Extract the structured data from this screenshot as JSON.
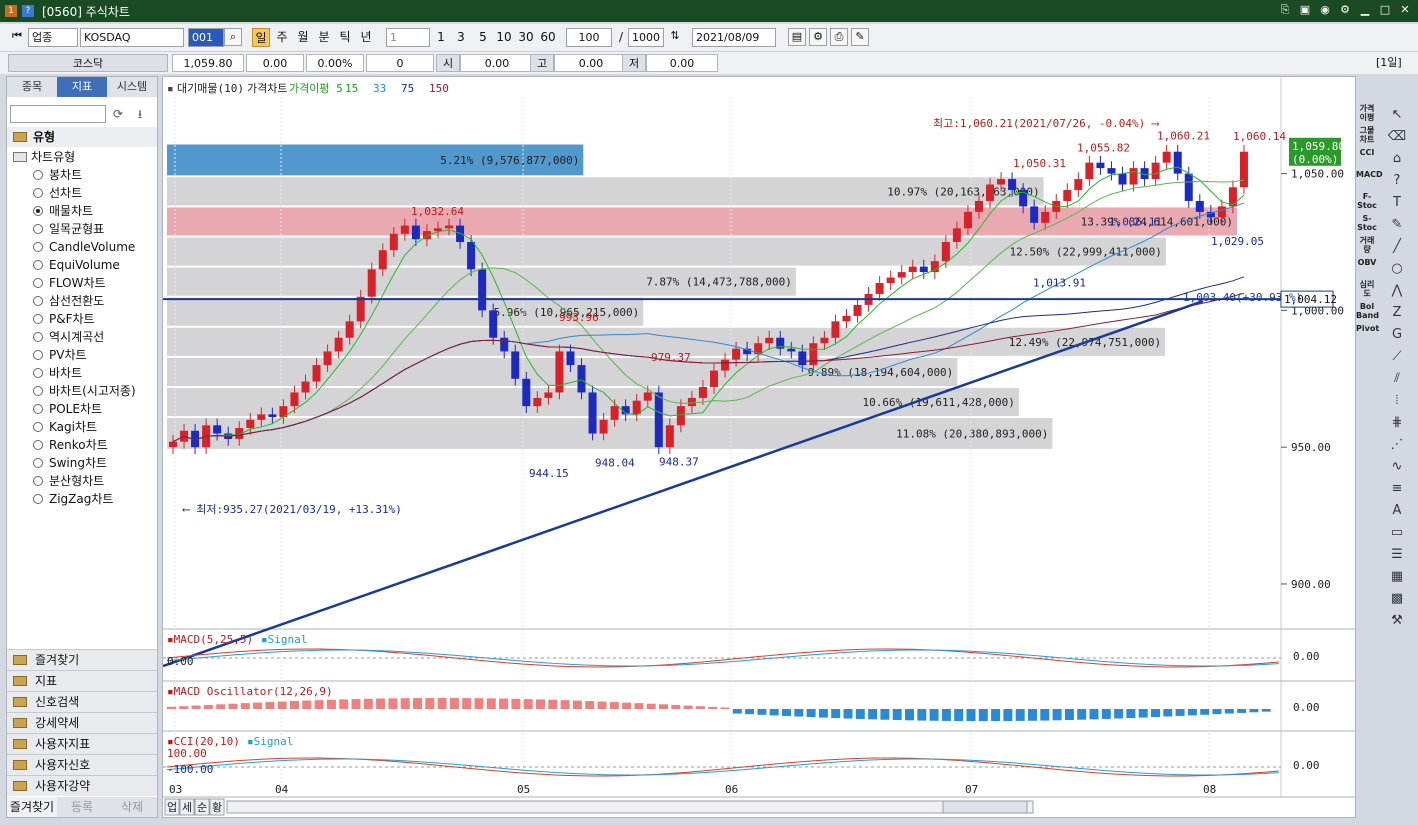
{
  "window": {
    "title": "[0560] 주식차트",
    "app_icons": [
      "1",
      "?"
    ]
  },
  "toolbar": {
    "market": "업종",
    "index": "KOSDAQ",
    "code": "001",
    "periods": [
      "일",
      "주",
      "월",
      "분",
      "틱",
      "년"
    ],
    "interval_select": "1",
    "quick_intervals": [
      "1",
      "3",
      "5",
      "10",
      "30",
      "60"
    ],
    "count": "100",
    "total": "1000",
    "date": "2021/08/09",
    "cycle": "[1일]"
  },
  "quote": {
    "name": "코스닥",
    "price": "1,059.80",
    "change": "0.00",
    "rate": "0.00%",
    "volume": "0",
    "open_label": "시",
    "open": "0.00",
    "high_label": "고",
    "high": "0.00",
    "low_label": "저",
    "low": "0.00"
  },
  "left_panel": {
    "tabs": [
      "종목",
      "지표",
      "시스템"
    ],
    "active_tab": "지표",
    "category": "유형",
    "tree_root": "차트유형",
    "items": [
      "봉차트",
      "선차트",
      "매물차트",
      "일목균형표",
      "CandleVolume",
      "EquiVolume",
      "FLOW차트",
      "삼선전환도",
      "P&F차트",
      "역시계곡선",
      "PV차트",
      "바차트",
      "바차트(시고저종)",
      "POLE차트",
      "Kagi차트",
      "Renko차트",
      "Swing차트",
      "분산형차트",
      "ZigZag차트"
    ],
    "selected_item": "매물차트",
    "bottom_sections": [
      "즐겨찾기",
      "지표",
      "신호검색",
      "강세약세",
      "사용자지표",
      "사용자신호",
      "사용자강약"
    ],
    "footer": [
      "즐겨찾기",
      "등록",
      "삭제"
    ]
  },
  "chart_data": {
    "type": "candlestick",
    "legend": [
      "대기매물(10)",
      "가격차트",
      "가격이평 5",
      "15",
      "33",
      "75",
      "150"
    ],
    "legend_colors": [
      "#222222",
      "#222222",
      "#1aa01a",
      "#1aa01a",
      "#1e88d8",
      "#1a2a8a",
      "#8a1a3a"
    ],
    "x_ticks": [
      "03",
      "04",
      "05",
      "06",
      "07",
      "08"
    ],
    "y_ticks": [
      "1,050.00",
      "1,000.00",
      "950.00",
      "900.00"
    ],
    "ylim": [
      885,
      1078
    ],
    "current_price": "1,059.80",
    "current_change": "(0.00%)",
    "trend_price": "1,004.12",
    "annotations": {
      "high": "최고:1,060.21(2021/07/26, -0.04%)",
      "low": "최저:935.27(2021/03/19, +13.31%)",
      "trend_label": "1,003.40(+30.93 %)"
    },
    "price_labels": [
      {
        "text": "1,032.64",
        "value": 1032.64,
        "color": "#c01818"
      },
      {
        "text": "944.15",
        "value": 944.15,
        "color": "#1a2a9a"
      },
      {
        "text": "993.96",
        "value": 993.96,
        "color": "#c01818"
      },
      {
        "text": "948.04",
        "value": 948.04,
        "color": "#1a2a9a"
      },
      {
        "text": "979.37",
        "value": 979.37,
        "color": "#c01818"
      },
      {
        "text": "948.37",
        "value": 948.37,
        "color": "#1a2a9a"
      },
      {
        "text": "1,050.31",
        "value": 1050.31,
        "color": "#c01818"
      },
      {
        "text": "1,013.91",
        "value": 1013.91,
        "color": "#1a2a9a"
      },
      {
        "text": "1,055.82",
        "value": 1055.82,
        "color": "#c01818"
      },
      {
        "text": "1,036.11",
        "value": 1036.11,
        "color": "#1a2a9a"
      },
      {
        "text": "1,060.21",
        "value": 1060.21,
        "color": "#c01818"
      },
      {
        "text": "1,029.05",
        "value": 1029.05,
        "color": "#1a2a9a"
      },
      {
        "text": "1,060.14",
        "value": 1060.14,
        "color": "#c01818"
      }
    ],
    "volume_profile": [
      {
        "low": 1049,
        "high": 1061,
        "pct": "5.21%",
        "vol": "(9,576,877,000)"
      },
      {
        "low": 1038,
        "high": 1049,
        "pct": "10.97%",
        "vol": "(20,163,063,000)"
      },
      {
        "low": 1027,
        "high": 1038,
        "pct": "13.39%",
        "vol": "(24,614,601,000)"
      },
      {
        "low": 1016,
        "high": 1027,
        "pct": "12.50%",
        "vol": "(22,999,411,000)"
      },
      {
        "low": 1005,
        "high": 1016,
        "pct": "7.87%",
        "vol": "(14,473,788,000)"
      },
      {
        "low": 994,
        "high": 1005,
        "pct": "5.96%",
        "vol": "(10,965,215,000)"
      },
      {
        "low": 983,
        "high": 994,
        "pct": "12.49%",
        "vol": "(22,974,751,000)"
      },
      {
        "low": 972,
        "high": 983,
        "pct": "9.89%",
        "vol": "(18,194,604,000)"
      },
      {
        "low": 961,
        "high": 972,
        "pct": "10.66%",
        "vol": "(19,611,428,000)"
      },
      {
        "low": 949,
        "high": 961,
        "pct": "11.08%",
        "vol": "(20,380,893,000)"
      }
    ],
    "closes": [
      952,
      956,
      950,
      958,
      955,
      953,
      957,
      960,
      962,
      961,
      965,
      970,
      974,
      980,
      985,
      990,
      996,
      1005,
      1015,
      1022,
      1028,
      1031,
      1026,
      1029,
      1030,
      1031,
      1025,
      1015,
      1000,
      990,
      985,
      975,
      965,
      968,
      970,
      985,
      980,
      970,
      955,
      960,
      965,
      962,
      967,
      970,
      950,
      958,
      965,
      968,
      972,
      978,
      982,
      986,
      984,
      988,
      990,
      986,
      985,
      980,
      988,
      990,
      996,
      998,
      1002,
      1006,
      1010,
      1012,
      1014,
      1016,
      1014,
      1018,
      1025,
      1030,
      1036,
      1040,
      1046,
      1048,
      1044,
      1038,
      1032,
      1036,
      1040,
      1044,
      1048,
      1054,
      1052,
      1050,
      1046,
      1052,
      1048,
      1054,
      1058,
      1050,
      1040,
      1036,
      1034,
      1038,
      1045,
      1058
    ]
  },
  "indicators": [
    {
      "name": "MACD(5,25,5)",
      "signal": "Signal",
      "left_value": "0.00",
      "right_value": "0.00"
    },
    {
      "name": "MACD Oscillator(12,26,9)",
      "right_value": "0.00"
    },
    {
      "name": "CCI(20,10)",
      "signal": "Signal",
      "left_value_top": "100.00",
      "left_value_bottom": "-100.00",
      "right_value": "0.00"
    }
  ],
  "bottom_bar": {
    "labels": [
      "업",
      "세",
      "순",
      "황"
    ]
  },
  "right_indicators": [
    "가격이평",
    "그물차트",
    "CCI",
    "MACD",
    "F-Stoc",
    "S-Stoc",
    "거래량",
    "OBV",
    "심리도",
    "Bol Band",
    "Pivot"
  ]
}
